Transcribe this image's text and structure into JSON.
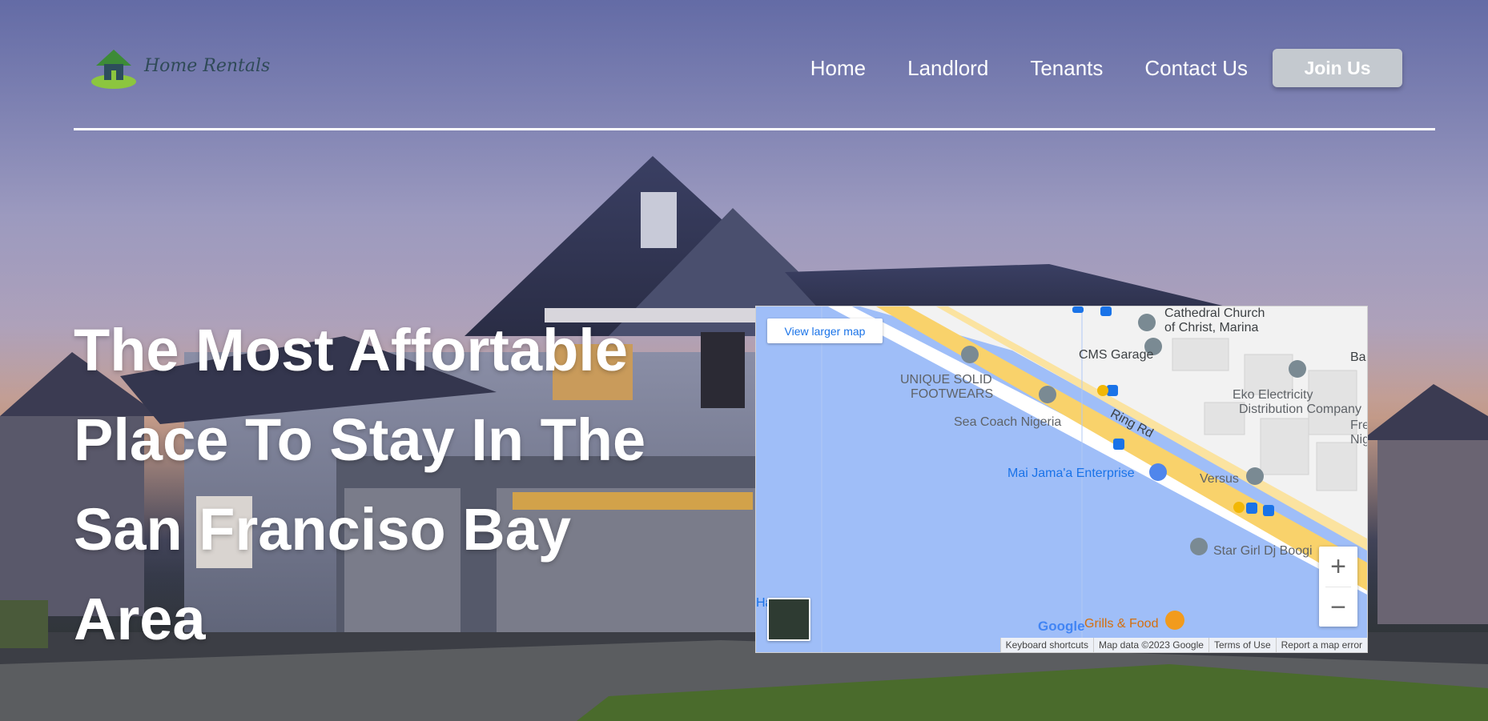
{
  "header": {
    "logo_text": "Home Rentals",
    "nav": [
      "Home",
      "Landlord",
      "Tenants",
      "Contact Us"
    ],
    "join_label": "Join Us"
  },
  "hero": {
    "headline_lines": [
      "The Most Affortable",
      "Place To Stay In The",
      "San Franciso Bay",
      "Area"
    ]
  },
  "map": {
    "view_larger": "View larger map",
    "places": {
      "cathedral": "Cathedral Church",
      "cathedral2": "of Christ, Marina",
      "cms": "CMS Garage",
      "unique1": "UNIQUE SOLID",
      "unique2": "FOOTWEARS",
      "eko1": "Eko Electricity",
      "eko2": "Distribution Company",
      "seacoach": "Sea Coach Nigeria",
      "ringrd": "Ring Rd",
      "mai": "Mai Jama'a Enterprise",
      "versus": "Versus",
      "stargirl": "Star Girl Dj Boogi",
      "grills": "Grills & Food",
      "ba": "Ba",
      "free1": "Free",
      "free2": "Nig",
      "ha": "Ha"
    },
    "google": "Google",
    "attribution": [
      "Keyboard shortcuts",
      "Map data ©2023 Google",
      "Terms of Use",
      "Report a map error"
    ],
    "zoom_in": "+",
    "zoom_out": "−"
  }
}
